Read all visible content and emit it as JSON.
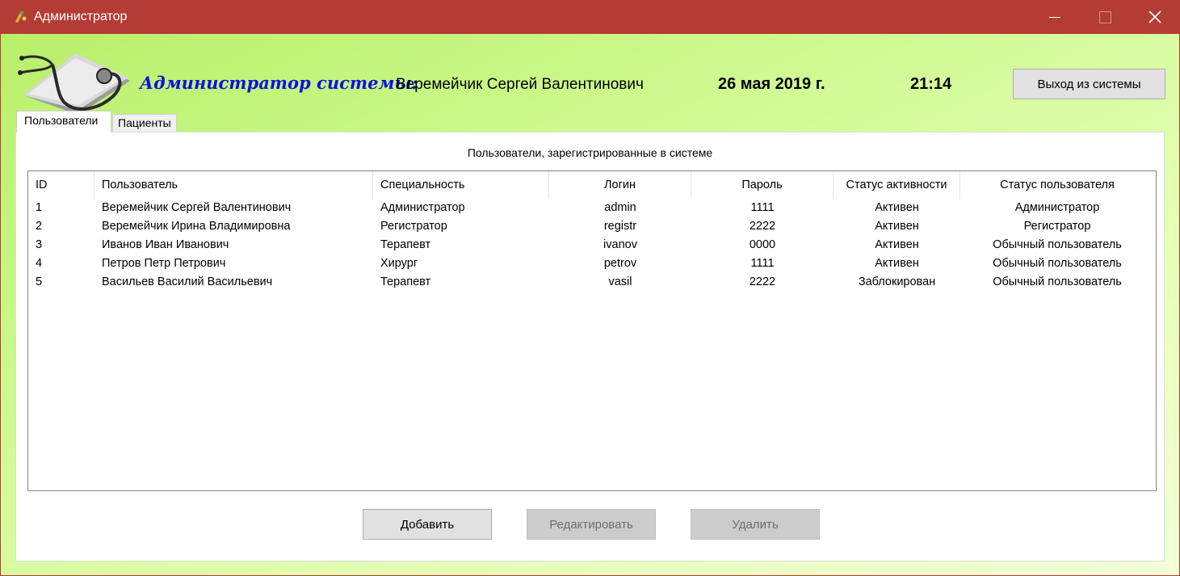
{
  "window": {
    "title": "Администратор",
    "accent_color": "#b33c35"
  },
  "header": {
    "role_title": "Администратор системы:",
    "user_name": "Веремейчик Сергей Валентинович",
    "date": "26 мая 2019 г.",
    "time": "21:14",
    "logout_label": "Выход из системы"
  },
  "tabs": [
    {
      "label": "Пользователи",
      "active": true
    },
    {
      "label": "Пациенты",
      "active": false
    }
  ],
  "users_panel": {
    "caption": "Пользователи, зарегистрированные в системе",
    "columns": [
      "ID",
      "Пользователь",
      "Специальность",
      "Логин",
      "Пароль",
      "Статус активности",
      "Статус пользователя"
    ],
    "rows": [
      [
        "1",
        "Веремейчик Сергей Валентинович",
        "Администратор",
        "admin",
        "1111",
        "Активен",
        "Администратор"
      ],
      [
        "2",
        "Веремейчик Ирина Владимировна",
        "Регистратор",
        "registr",
        "2222",
        "Активен",
        "Регистратор"
      ],
      [
        "3",
        "Иванов Иван Иванович",
        "Терапевт",
        "ivanov",
        "0000",
        "Активен",
        "Обычный пользователь"
      ],
      [
        "4",
        "Петров Петр Петрович",
        "Хирург",
        "petrov",
        "1111",
        "Активен",
        "Обычный пользователь"
      ],
      [
        "5",
        "Васильев Василий Васильевич",
        "Терапевт",
        "vasil",
        "2222",
        "Заблокирован",
        "Обычный пользователь"
      ]
    ]
  },
  "actions": {
    "add_label": "Добавить",
    "edit_label": "Редактировать",
    "delete_label": "Удалить"
  }
}
